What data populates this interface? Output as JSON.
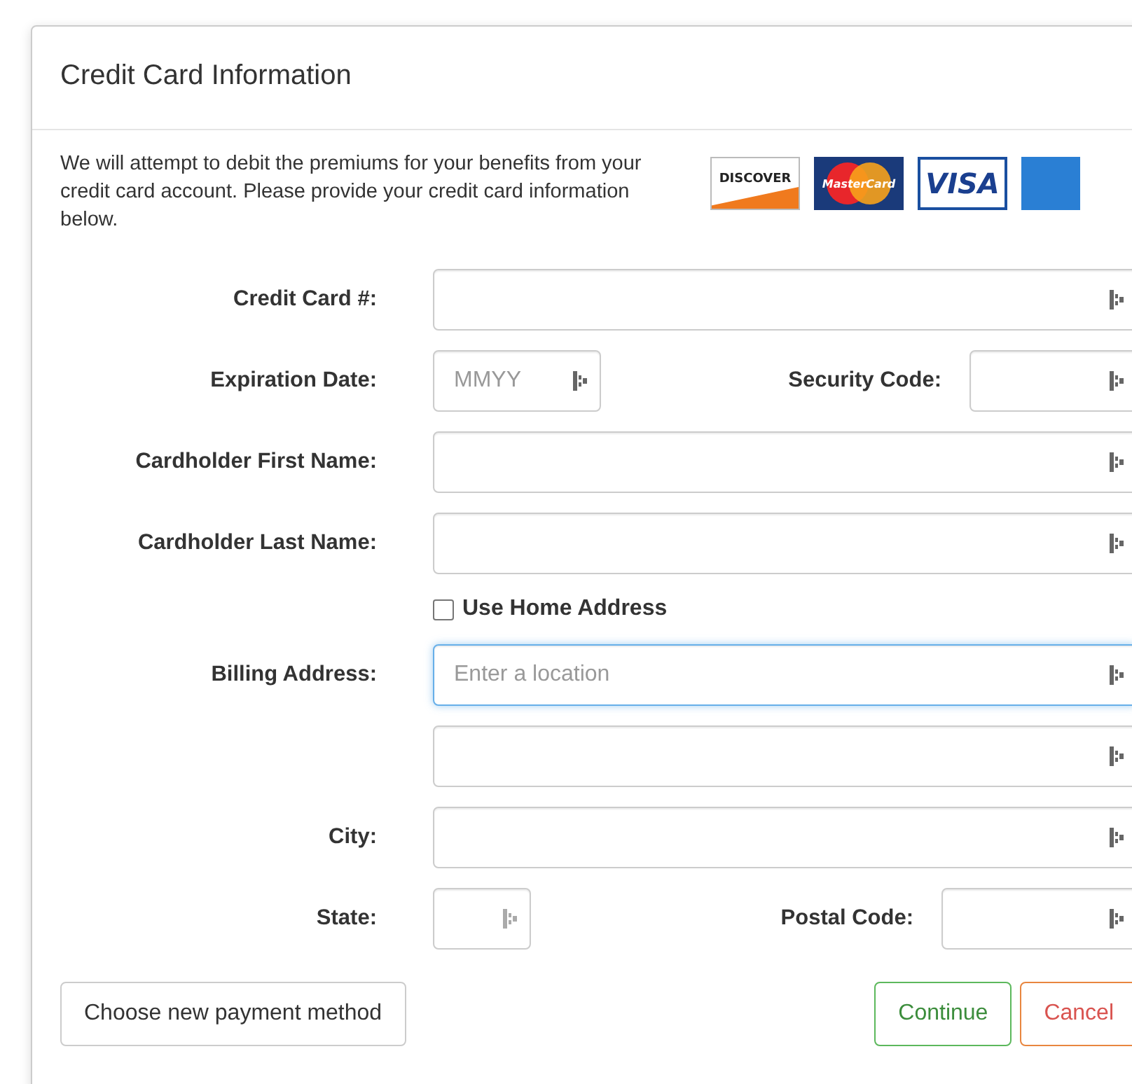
{
  "title": "Credit Card Information",
  "intro": "We will attempt to debit the premiums for your benefits from your credit card account. Please provide your credit card information below.",
  "card_logos": [
    {
      "kind": "discover",
      "text": "DISCOVER"
    },
    {
      "kind": "mastercard",
      "text": "MasterCard"
    },
    {
      "kind": "visa",
      "text": "VISA"
    },
    {
      "kind": "amex"
    }
  ],
  "rows": [
    {
      "kind": "full",
      "label": "Credit Card #:"
    },
    {
      "kind": "pair",
      "label": "Expiration Date:",
      "placeholder": "MMYY",
      "label_2": "Security Code:"
    },
    {
      "kind": "full",
      "label": "Cardholder First Name:"
    },
    {
      "kind": "full",
      "label": "Cardholder Last Name:"
    },
    {
      "kind": "checkbox",
      "label": "Use Home Address",
      "checked": false
    },
    {
      "kind": "full",
      "label": "Billing Address:",
      "placeholder": "Enter a location",
      "focused": true
    },
    {
      "kind": "full"
    },
    {
      "kind": "full",
      "label": "City:"
    },
    {
      "kind": "pair",
      "label": "State:",
      "label_2": "Postal Code:",
      "narrow": true
    }
  ],
  "buttons": [
    {
      "kind": "default",
      "label": "Choose new payment method"
    },
    {
      "kind": "success",
      "label": "Continue"
    },
    {
      "kind": "danger",
      "label": "Cancel"
    }
  ]
}
